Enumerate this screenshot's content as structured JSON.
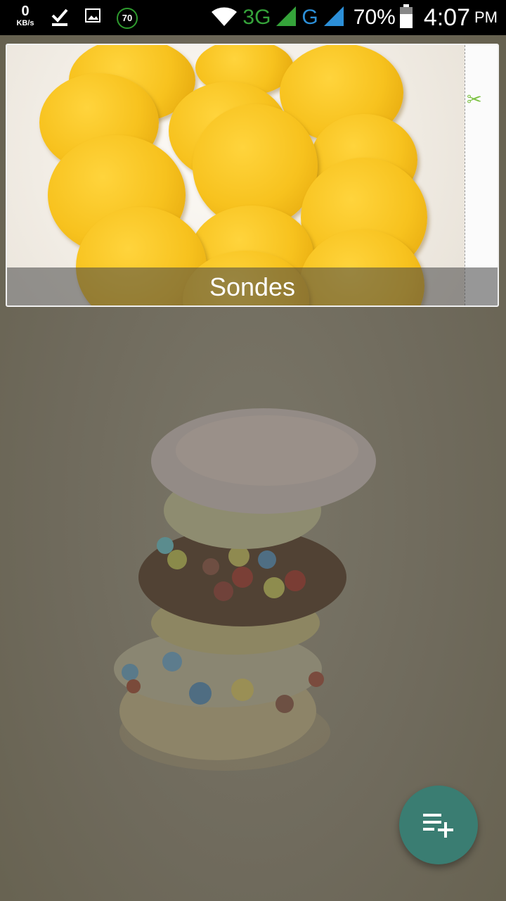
{
  "status_bar": {
    "speed_value": "0",
    "speed_unit": "KB/s",
    "badge": "70",
    "net_3g": "3G",
    "net_g": "G",
    "battery": "70%",
    "time": "4:07",
    "ampm": "PM",
    "icons": [
      "download-done-icon",
      "image-icon",
      "wifi-icon",
      "signal-icon",
      "battery-icon"
    ]
  },
  "card": {
    "title": "Sondes"
  },
  "fab": {
    "icon": "playlist-add-icon"
  }
}
